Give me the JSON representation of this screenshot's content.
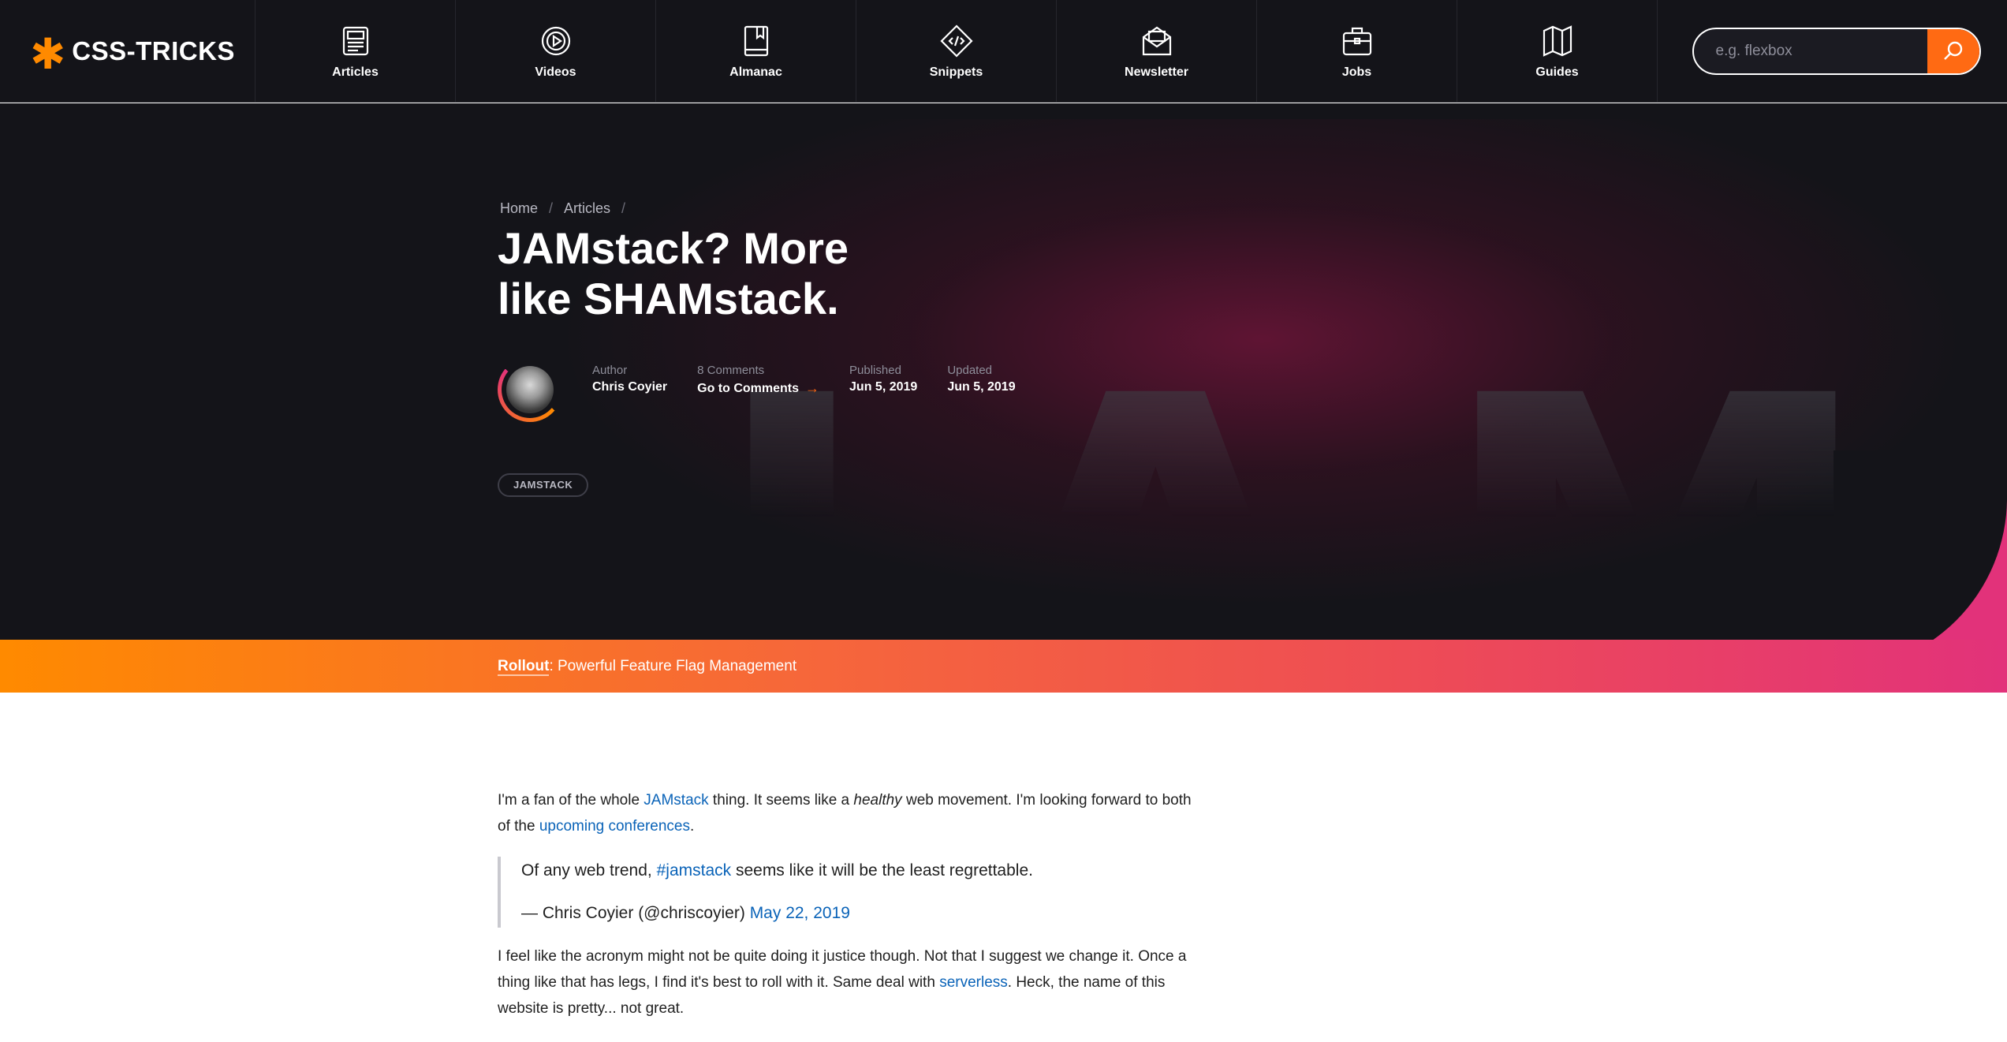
{
  "nav": {
    "logo": {
      "mark": "✱",
      "text": "CSS-TRICKS"
    },
    "items": [
      {
        "label": "Articles",
        "icon": "newspaper-icon"
      },
      {
        "label": "Videos",
        "icon": "play-circle-icon"
      },
      {
        "label": "Almanac",
        "icon": "book-icon"
      },
      {
        "label": "Snippets",
        "icon": "code-diamond-icon"
      },
      {
        "label": "Newsletter",
        "icon": "envelope-icon"
      },
      {
        "label": "Jobs",
        "icon": "briefcase-icon"
      },
      {
        "label": "Guides",
        "icon": "map-icon"
      }
    ],
    "search": {
      "placeholder": "e.g. flexbox",
      "button_icon": "search-icon"
    }
  },
  "hero": {
    "breadcrumb": [
      {
        "label": "Home"
      },
      {
        "label": "Articles"
      }
    ],
    "breadcrumb_sep": "/",
    "title": "JAMstack? More like SHAMstack.",
    "background_text": "JAM",
    "meta": {
      "author_key": "Author",
      "author_name": "Chris Coyier",
      "comments_count": "8 Comments",
      "comments_link": "Go to Comments",
      "published_key": "Published",
      "published_date": "Jun 5, 2019",
      "updated_key": "Updated",
      "updated_date": "Jun 5, 2019"
    },
    "tag": "JAMSTACK"
  },
  "banner": {
    "brand": "Rollout",
    "text": ": Powerful Feature Flag Management"
  },
  "article": {
    "p1": {
      "before": "I'm a fan of the whole ",
      "link1": "JAMstack",
      "mid1": " thing. It seems like a ",
      "em": "healthy",
      "mid2": " web movement. I'm looking forward to both of the ",
      "link2": "upcoming conferences",
      "after": "."
    },
    "quote": {
      "before": "Of any web trend, ",
      "hashtag": "#jamstack",
      "after": " seems like it will be the least regrettable.",
      "cite": "— Chris Coyier (@chriscoyier) ",
      "date_link": "May 22, 2019"
    },
    "p2": {
      "before": "I feel like the acronym might not be quite doing it justice though. Not that I suggest we change it. Once a thing like that has legs, I find it's best to roll with it. Same deal with ",
      "link": "serverless",
      "after": ". Heck, the name of this website is pretty... not great."
    }
  },
  "colors": {
    "accent_orange": "#ff8a00",
    "accent_pink": "#e2327a",
    "nav_bg": "#141419",
    "link_blue": "#0a63b8"
  }
}
